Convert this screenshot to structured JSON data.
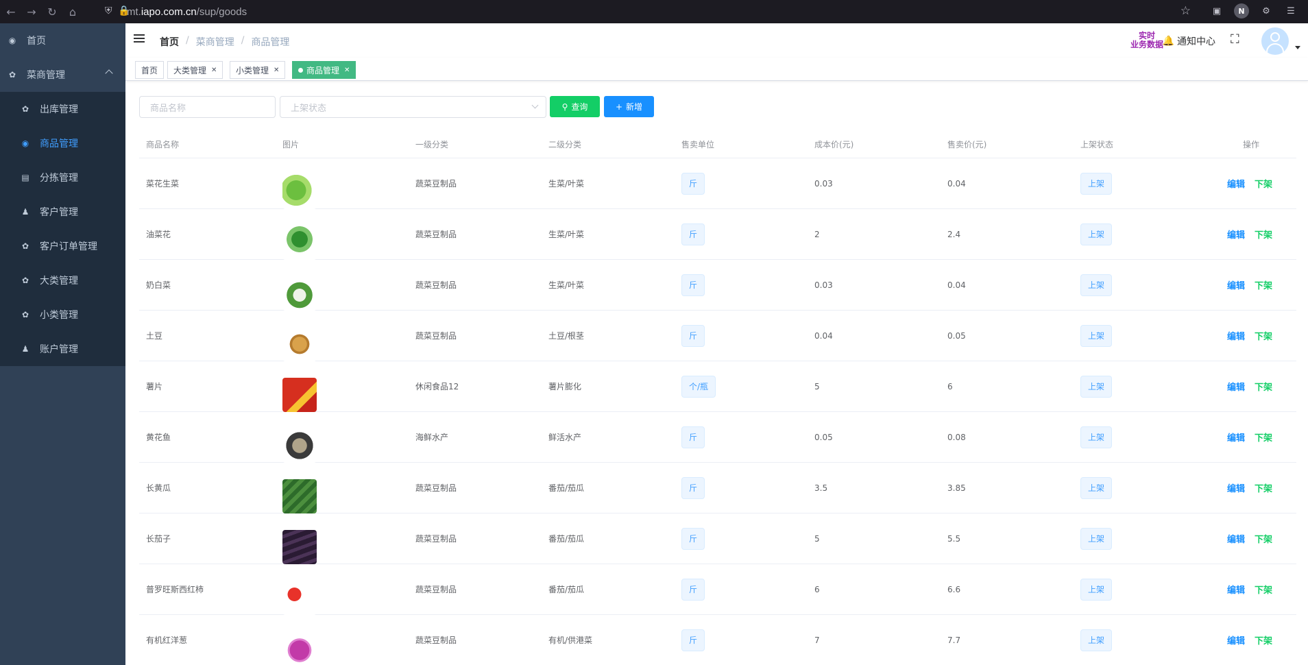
{
  "browser": {
    "url_prefix": "mt.",
    "url_domain": "iapo.com.cn",
    "url_path": "/sup/goods"
  },
  "sidebar": {
    "items": [
      {
        "label": "首页",
        "icon": "dashboard-icon"
      },
      {
        "label": "菜商管理",
        "icon": "grid-icon"
      }
    ],
    "sub_items": [
      {
        "label": "出库管理",
        "icon": "grid-icon"
      },
      {
        "label": "商品管理",
        "icon": "dashboard-icon"
      },
      {
        "label": "分拣管理",
        "icon": "document-icon"
      },
      {
        "label": "客户管理",
        "icon": "users-icon"
      },
      {
        "label": "客户订单管理",
        "icon": "grid-icon"
      },
      {
        "label": "大类管理",
        "icon": "grid-icon"
      },
      {
        "label": "小类管理",
        "icon": "grid-icon"
      },
      {
        "label": "账户管理",
        "icon": "user-icon"
      }
    ]
  },
  "header": {
    "breadcrumb": [
      "首页",
      "菜商管理",
      "商品管理"
    ],
    "realtime_line1": "实时",
    "realtime_line2": "业务数据",
    "notice": "通知中心"
  },
  "tags": [
    "首页",
    "大类管理",
    "小类管理",
    "商品管理"
  ],
  "search": {
    "name_placeholder": "商品名称",
    "status_placeholder": "上架状态",
    "query_label": "查询",
    "add_label": "新增"
  },
  "table": {
    "columns": [
      "商品名称",
      "图片",
      "一级分类",
      "二级分类",
      "售卖单位",
      "成本价(元)",
      "售卖价(元)",
      "上架状态",
      "操作"
    ],
    "rows": [
      {
        "name": "菜花生菜",
        "cat1": "蔬菜豆制品",
        "cat2": "生菜/叶菜",
        "unit": "斤",
        "cost": "0.03",
        "price": "0.04",
        "status": "上架"
      },
      {
        "name": "油菜花",
        "cat1": "蔬菜豆制品",
        "cat2": "生菜/叶菜",
        "unit": "斤",
        "cost": "2",
        "price": "2.4",
        "status": "上架"
      },
      {
        "name": "奶白菜",
        "cat1": "蔬菜豆制品",
        "cat2": "生菜/叶菜",
        "unit": "斤",
        "cost": "0.03",
        "price": "0.04",
        "status": "上架"
      },
      {
        "name": "土豆",
        "cat1": "蔬菜豆制品",
        "cat2": "土豆/根茎",
        "unit": "斤",
        "cost": "0.04",
        "price": "0.05",
        "status": "上架"
      },
      {
        "name": "薯片",
        "cat1": "休闲食品12",
        "cat2": "薯片膨化",
        "unit": "个/瓶",
        "cost": "5",
        "price": "6",
        "status": "上架"
      },
      {
        "name": "黄花鱼",
        "cat1": "海鲜水产",
        "cat2": "鲜活水产",
        "unit": "斤",
        "cost": "0.05",
        "price": "0.08",
        "status": "上架"
      },
      {
        "name": "长黄瓜",
        "cat1": "蔬菜豆制品",
        "cat2": "番茄/茄瓜",
        "unit": "斤",
        "cost": "3.5",
        "price": "3.85",
        "status": "上架"
      },
      {
        "name": "长茄子",
        "cat1": "蔬菜豆制品",
        "cat2": "番茄/茄瓜",
        "unit": "斤",
        "cost": "5",
        "price": "5.5",
        "status": "上架"
      },
      {
        "name": "普罗旺斯西红柿",
        "cat1": "蔬菜豆制品",
        "cat2": "番茄/茄瓜",
        "unit": "斤",
        "cost": "6",
        "price": "6.6",
        "status": "上架"
      },
      {
        "name": "有机红洋葱",
        "cat1": "蔬菜豆制品",
        "cat2": "有机/供港菜",
        "unit": "斤",
        "cost": "7",
        "price": "7.7",
        "status": "上架"
      }
    ],
    "edit_label": "编辑",
    "offshelf_label": "下架"
  }
}
